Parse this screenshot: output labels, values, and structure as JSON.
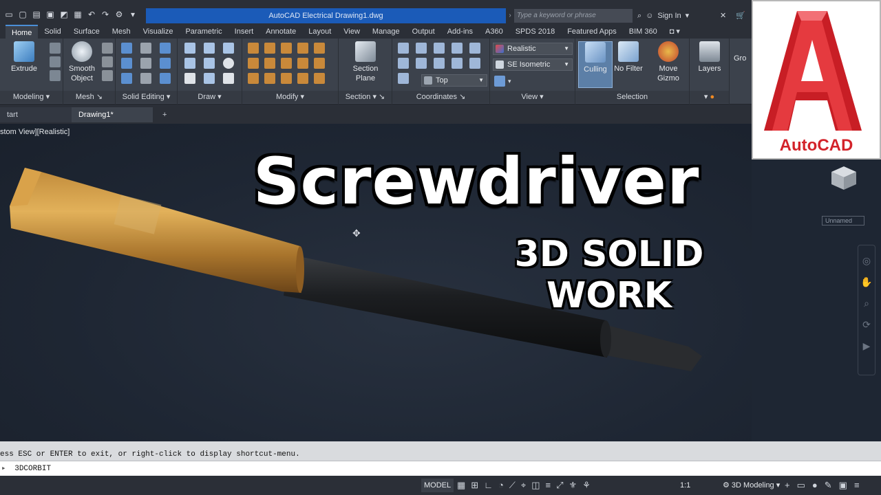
{
  "titlebar": {
    "title": "AutoCAD Electrical    Drawing1.dwg",
    "search_placeholder": "Type a keyword or phrase",
    "signin_label": "Sign In"
  },
  "ribbon_tabs": [
    "Home",
    "Solid",
    "Surface",
    "Mesh",
    "Visualize",
    "Parametric",
    "Insert",
    "Annotate",
    "Layout",
    "View",
    "Manage",
    "Output",
    "Add-ins",
    "A360",
    "SPDS 2018",
    "Featured Apps",
    "BIM 360"
  ],
  "ribbon": {
    "extrude": "Extrude",
    "smooth_object": "Smooth\nObject",
    "section_plane": "Section\nPlane",
    "culling": "Culling",
    "no_filter": "No Filter",
    "move_gizmo": "Move\nGizmo",
    "layers": "Layers",
    "groups": "Gro",
    "visual_style": "Realistic",
    "view_preset": "SE Isometric",
    "ucs_view": "Top",
    "panels": {
      "modeling": "Modeling",
      "mesh": "Mesh",
      "solid_editing": "Solid Editing",
      "draw": "Draw",
      "modify": "Modify",
      "section": "Section",
      "coordinates": "Coordinates",
      "view": "View",
      "selection": "Selection"
    }
  },
  "file_tabs": {
    "start": "tart",
    "drawing": "Drawing1*",
    "new_tab": "+"
  },
  "viewport": {
    "label": "stom View][Realistic]",
    "unnamed": "Unnamed"
  },
  "overlay": {
    "headline": "Screwdriver",
    "subheadline": "3D SOLID WORK"
  },
  "logo": {
    "text": "AutoCAD"
  },
  "command": {
    "history": "ess ESC or ENTER to exit, or right-click to display shortcut-menu.",
    "input": "3DCORBIT"
  },
  "statusbar": {
    "model": "MODEL",
    "scale": "1:1",
    "workspace": "3D Modeling"
  },
  "colors": {
    "titlebar": "#2b2f37",
    "ribbon": "#3c424c",
    "accent": "#1b5bb8",
    "logo_red": "#d3232a",
    "viewport": "#1e2633"
  }
}
